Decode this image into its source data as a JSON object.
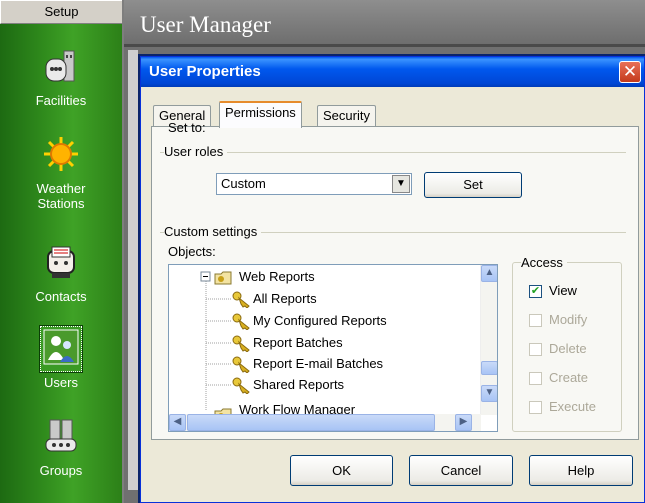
{
  "sidebar": {
    "header": "Setup",
    "items": [
      {
        "label_lines": [
          "Facilities"
        ],
        "icon": "building-icon"
      },
      {
        "label_lines": [
          "Weather",
          "Stations"
        ],
        "icon": "sun-icon"
      },
      {
        "label_lines": [
          "Contacts"
        ],
        "icon": "rolodex-icon"
      },
      {
        "label_lines": [
          "Users"
        ],
        "icon": "users-icon",
        "selected": true
      },
      {
        "label_lines": [
          "Groups"
        ],
        "icon": "groups-icon"
      }
    ]
  },
  "main": {
    "title": "User Manager"
  },
  "dialog": {
    "title": "User Properties",
    "tabs": [
      "General",
      "Permissions",
      "Security"
    ],
    "active_tab": "Permissions",
    "user_roles": {
      "legend": "User roles",
      "set_to_label": "Set to:",
      "set_to_value": "Custom",
      "set_button": "Set"
    },
    "custom_settings": {
      "legend": "Custom settings",
      "objects_label": "Objects:",
      "tree": [
        {
          "label": "Web Reports",
          "type": "folder",
          "expanded": true
        },
        {
          "label": "All Reports",
          "type": "key"
        },
        {
          "label": "My Configured Reports",
          "type": "key"
        },
        {
          "label": "Report Batches",
          "type": "key"
        },
        {
          "label": "Report E-mail Batches",
          "type": "key"
        },
        {
          "label": "Shared Reports",
          "type": "key"
        },
        {
          "label": "Work Flow Manager",
          "type": "folder",
          "partially_visible": true
        }
      ]
    },
    "access": {
      "legend": "Access",
      "options": [
        {
          "label": "View",
          "checked": true,
          "enabled": true
        },
        {
          "label": "Modify",
          "checked": false,
          "enabled": false
        },
        {
          "label": "Delete",
          "checked": false,
          "enabled": false
        },
        {
          "label": "Create",
          "checked": false,
          "enabled": false
        },
        {
          "label": "Execute",
          "checked": false,
          "enabled": false
        }
      ]
    },
    "buttons": {
      "ok": "OK",
      "cancel": "Cancel",
      "help": "Help"
    }
  }
}
